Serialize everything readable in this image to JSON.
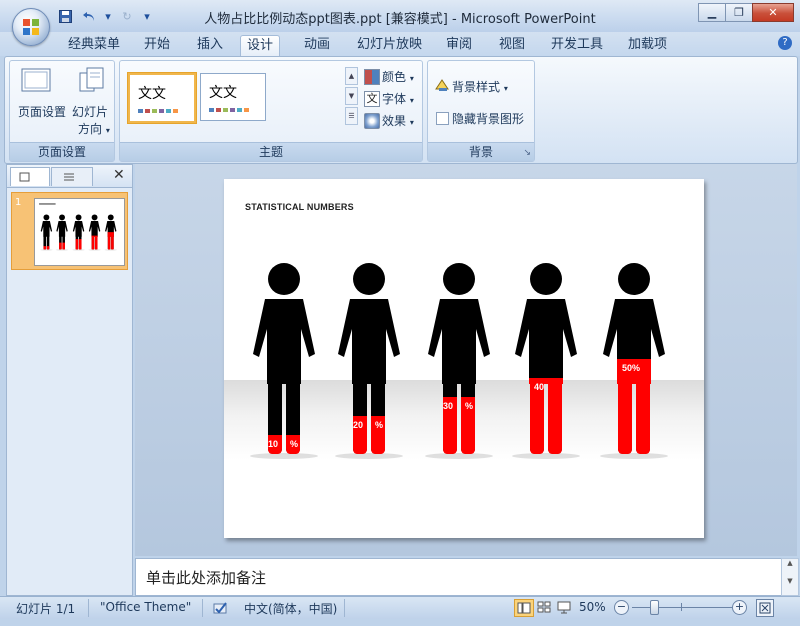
{
  "window": {
    "title": "人物占比比例动态ppt图表.ppt [兼容模式] - Microsoft PowerPoint"
  },
  "tabs": [
    "经典菜单",
    "开始",
    "插入",
    "设计",
    "动画",
    "幻灯片放映",
    "审阅",
    "视图",
    "开发工具",
    "加载项"
  ],
  "active_tab": "设计",
  "ribbon": {
    "page_setup": {
      "page_setup_label": "页面设置",
      "orientation_label": "幻灯片",
      "orientation_label2": "方向",
      "group_label": "页面设置"
    },
    "themes": {
      "theme1_text": "文文",
      "theme2_text": "文文",
      "colors_label": "颜色",
      "fonts_label": "字体",
      "effects_label": "效果",
      "group_label": "主题"
    },
    "background": {
      "styles_label": "背景样式",
      "hide_graphics_label": "隐藏背景图形",
      "group_label": "背景"
    }
  },
  "slides_panel": {
    "slide_number": "1"
  },
  "slide": {
    "title": "STATISTICAL NUMBERS",
    "figure_color": "#000000",
    "fill_color": "#ff0000",
    "figures": [
      {
        "label_a": "10",
        "label_b": "%",
        "fill_pct": 10
      },
      {
        "label_a": "20",
        "label_b": "%",
        "fill_pct": 20
      },
      {
        "label_a": "30",
        "label_b": "%",
        "fill_pct": 30
      },
      {
        "label_a": "40",
        "label_b": "%",
        "fill_pct": 40
      },
      {
        "label_a": "50%",
        "label_b": "",
        "fill_pct": 50
      }
    ]
  },
  "notes": {
    "placeholder": "单击此处添加备注"
  },
  "status": {
    "slide_count": "幻灯片 1/1",
    "theme_name": "\"Office Theme\"",
    "language": "中文(简体，中国)",
    "zoom": "50%"
  }
}
